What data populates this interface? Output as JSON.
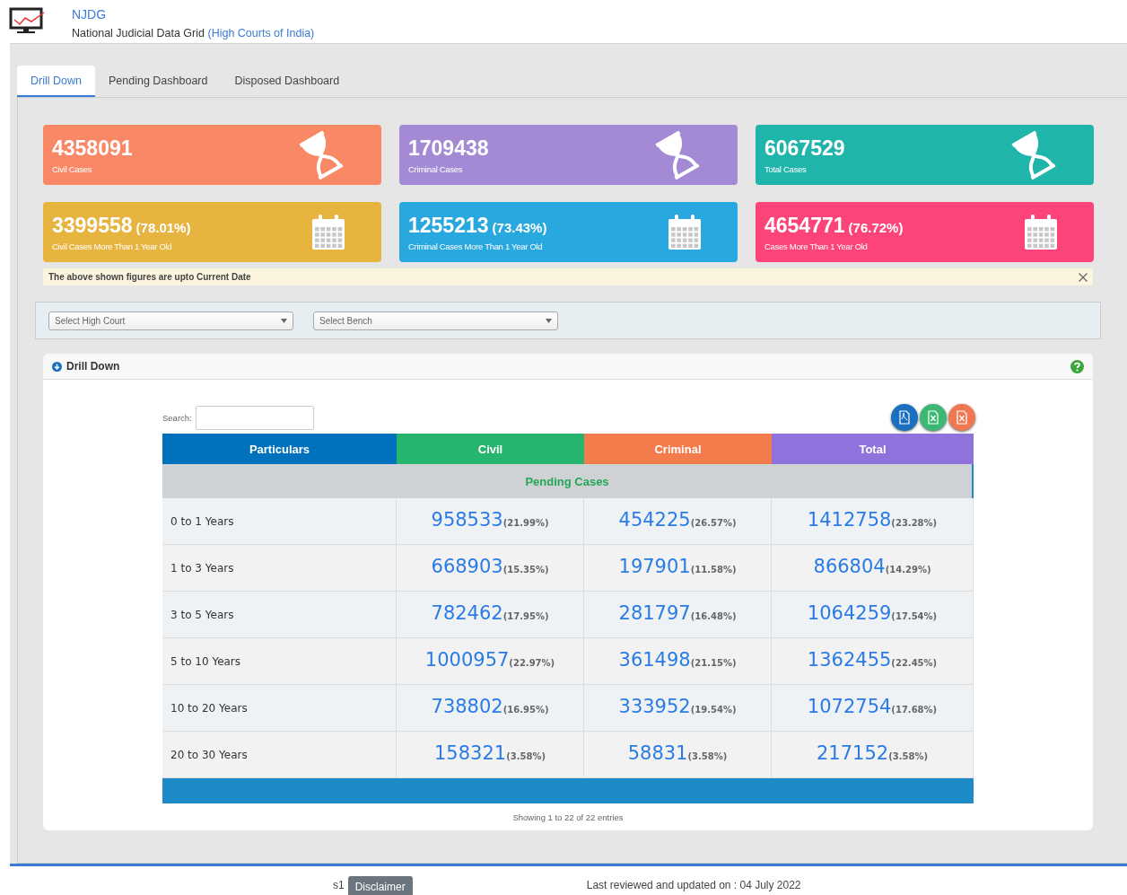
{
  "header": {
    "title": "NJDG",
    "subtitle": "National Judicial Data Grid",
    "subtitle_link": "(High Courts of India)"
  },
  "tabs": [
    {
      "label": "Drill Down",
      "selected": true
    },
    {
      "label": "Pending Dashboard",
      "selected": false
    },
    {
      "label": "Disposed Dashboard",
      "selected": false
    }
  ],
  "cards": [
    {
      "kind": "hourglass",
      "value": "4358091",
      "label": "Civil Cases",
      "color": "#f98866"
    },
    {
      "kind": "hourglass",
      "value": "1709438",
      "label": "Criminal Cases",
      "color": "#a48ad4"
    },
    {
      "kind": "hourglass",
      "value": "6067529",
      "label": "Total Cases",
      "color": "#20b5ab"
    },
    {
      "kind": "calendar",
      "value": "3399558",
      "percent": "(78.01%)",
      "label": "Civil Cases More Than 1 Year Old",
      "color": "#e8b440"
    },
    {
      "kind": "calendar",
      "value": "1255213",
      "percent": "(73.43%)",
      "label": "Criminal Cases More Than 1 Year Old",
      "color": "#29a8e0"
    },
    {
      "kind": "calendar",
      "value": "4654771",
      "percent": "(76.72%)",
      "label": "Cases More Than 1 Year Old",
      "color": "#fd4479"
    }
  ],
  "notice": "The above shown figures are upto Current Date",
  "filters": [
    {
      "placeholder": "Select High Court"
    },
    {
      "placeholder": "Select Bench"
    }
  ],
  "panel": {
    "title": "Drill Down",
    "search_label": "Search:",
    "exports": [
      {
        "kind": "pdf",
        "color": "#1a6fbf"
      },
      {
        "kind": "excel",
        "color": "#3db774"
      },
      {
        "kind": "other",
        "color": "#f07850"
      }
    ]
  },
  "table": {
    "columns": [
      {
        "label": "Particulars",
        "color": "#0071bc"
      },
      {
        "label": "Civil",
        "color": "#25b56f"
      },
      {
        "label": "Criminal",
        "color": "#f37b4c"
      },
      {
        "label": "Total",
        "color": "#8f72dc"
      }
    ],
    "group": "Pending Cases",
    "rows": [
      {
        "cells": [
          {
            "kind": "label",
            "text": "0 to 1 Years"
          },
          {
            "kind": "count",
            "value": "958533",
            "percent": "(21.99%)"
          },
          {
            "kind": "count",
            "value": "454225",
            "percent": "(26.57%)"
          },
          {
            "kind": "count",
            "value": "1412758",
            "percent": "(23.28%)"
          }
        ]
      },
      {
        "cells": [
          {
            "kind": "label",
            "text": "1 to 3 Years"
          },
          {
            "kind": "count",
            "value": "668903",
            "percent": "(15.35%)"
          },
          {
            "kind": "count",
            "value": "197901",
            "percent": "(11.58%)"
          },
          {
            "kind": "count",
            "value": "866804",
            "percent": "(14.29%)"
          }
        ]
      },
      {
        "cells": [
          {
            "kind": "label",
            "text": "3 to 5 Years"
          },
          {
            "kind": "count",
            "value": "782462",
            "percent": "(17.95%)"
          },
          {
            "kind": "count",
            "value": "281797",
            "percent": "(16.48%)"
          },
          {
            "kind": "count",
            "value": "1064259",
            "percent": "(17.54%)"
          }
        ]
      },
      {
        "cells": [
          {
            "kind": "label",
            "text": "5 to 10 Years"
          },
          {
            "kind": "count",
            "value": "1000957",
            "percent": "(22.97%)"
          },
          {
            "kind": "count",
            "value": "361498",
            "percent": "(21.15%)"
          },
          {
            "kind": "count",
            "value": "1362455",
            "percent": "(22.45%)"
          }
        ]
      },
      {
        "cells": [
          {
            "kind": "label",
            "text": "10 to 20 Years"
          },
          {
            "kind": "count",
            "value": "738802",
            "percent": "(16.95%)"
          },
          {
            "kind": "count",
            "value": "333952",
            "percent": "(19.54%)"
          },
          {
            "kind": "count",
            "value": "1072754",
            "percent": "(17.68%)"
          }
        ]
      },
      {
        "cells": [
          {
            "kind": "label",
            "text": "20 to 30 Years"
          },
          {
            "kind": "count",
            "value": "158321",
            "percent": "(3.58%)"
          },
          {
            "kind": "count",
            "value": "58831",
            "percent": "(3.58%)"
          },
          {
            "kind": "count",
            "value": "217152",
            "percent": "(3.58%)"
          }
        ]
      }
    ],
    "info": "Showing 1 to 22 of 22 entries"
  },
  "footer": {
    "code": "s1",
    "disclaimer": "Disclaimer",
    "updated": "Last reviewed and updated on : 04 July 2022"
  }
}
